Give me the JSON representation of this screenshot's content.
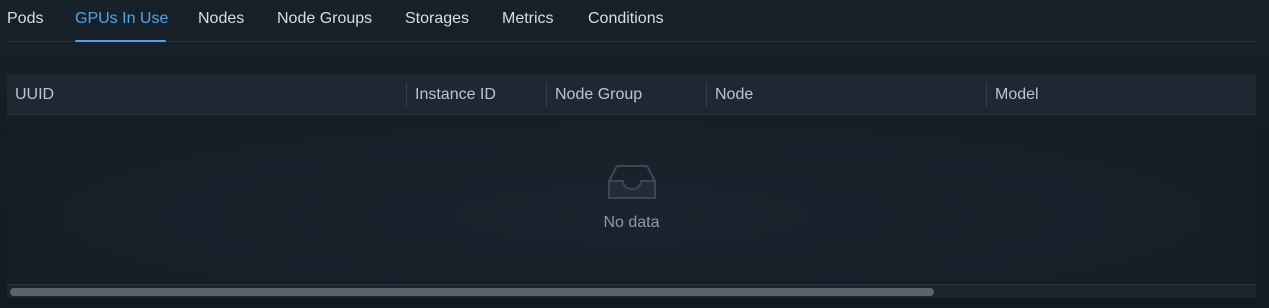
{
  "tabs": [
    {
      "label": "Pods",
      "active": false
    },
    {
      "label": "GPUs In Use",
      "active": true
    },
    {
      "label": "Nodes",
      "active": false
    },
    {
      "label": "Node Groups",
      "active": false
    },
    {
      "label": "Storages",
      "active": false
    },
    {
      "label": "Metrics",
      "active": false
    },
    {
      "label": "Conditions",
      "active": false
    }
  ],
  "table": {
    "columns": [
      "UUID",
      "Instance ID",
      "Node Group",
      "Node",
      "Model"
    ],
    "rows": [],
    "empty": {
      "icon": "inbox-icon",
      "text": "No data"
    }
  },
  "colors": {
    "accent": "#4aa8e8",
    "background": "#151d25",
    "header": "#1d2833"
  }
}
